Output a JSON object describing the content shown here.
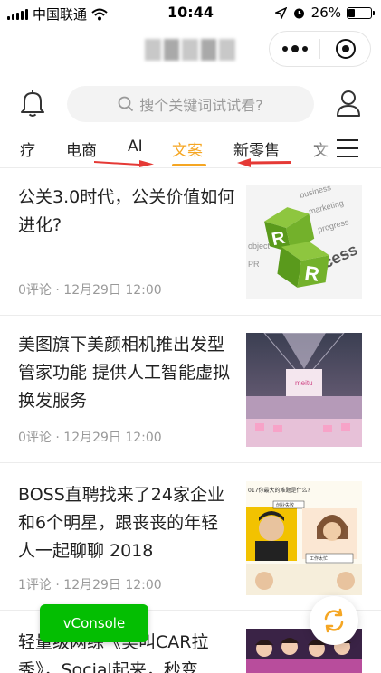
{
  "status_bar": {
    "carrier": "中国联通",
    "time": "10:44",
    "battery_percent": "26%",
    "battery_level": 0.26
  },
  "search": {
    "placeholder": "搜个关键词试试看?"
  },
  "tabs": [
    {
      "label": "疗",
      "active": false
    },
    {
      "label": "电商",
      "active": false
    },
    {
      "label": "AI",
      "active": false
    },
    {
      "label": "文案",
      "active": true
    },
    {
      "label": "新零售",
      "active": false
    },
    {
      "label": "文",
      "active": false
    }
  ],
  "articles": [
    {
      "title": "公关3.0时代，公关价值如何进化?",
      "comments": "0评论",
      "date": "12月29日 12:00",
      "thumb": "pr-cubes"
    },
    {
      "title": "美图旗下美颜相机推出发型管家功能 提供人工智能虚拟换发服务",
      "comments": "0评论",
      "date": "12月29日 12:00",
      "thumb": "stage-event"
    },
    {
      "title": "BOSS直聘找来了24家企业和6个明星，跟丧丧的年轻人一起聊聊 2018",
      "comments": "1评论",
      "date": "12月29日 12:00",
      "thumb": "comic-poster"
    },
    {
      "title": "轻量级网综《美叫CAR拉秀》，Social起来，秒变",
      "comments": "",
      "date": "",
      "thumb": "group-photo"
    }
  ],
  "thumb_text": {
    "pr_cubes": {
      "r1": "R",
      "r2": "R"
    },
    "comic": {
      "headline": "017你最大的难题是什么?",
      "tag1": "创业失败",
      "tag2": "工作太忙"
    },
    "stage": {
      "sign": "meitu"
    }
  },
  "vconsole": {
    "label": "vConsole"
  },
  "colors": {
    "accent": "#f5a623",
    "vconsole": "#04be02",
    "arrow": "#e53935"
  }
}
